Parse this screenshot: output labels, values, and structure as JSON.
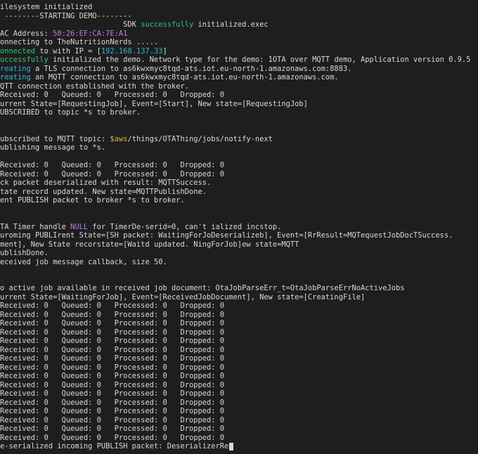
{
  "lines": [
    [
      {
        "t": "ilesystem initialized"
      }
    ],
    [
      {
        "t": " --------STARTING DEMO--------"
      }
    ],
    [
      {
        "t": "                            SDK "
      },
      {
        "t": "successfully",
        "c": "g"
      },
      {
        "t": " initialized.exec"
      }
    ],
    [
      {
        "t": "AC Address: "
      },
      {
        "t": "50:26:EF:CA:7E:A1",
        "c": "m"
      }
    ],
    [
      {
        "t": "onnecting to TheNutritionNerds ....."
      }
    ],
    [
      {
        "t": "onnected ",
        "c": "g"
      },
      {
        "t": "to with IP = ["
      },
      {
        "t": "192.168.137.33",
        "c": "c"
      },
      {
        "t": "]"
      }
    ],
    [
      {
        "t": "uccessfully ",
        "c": "g"
      },
      {
        "t": "initialized the demo. Network type for the demo: 1OTA over MQTT demo, Application version 0.9.5"
      }
    ],
    [
      {
        "t": "reating ",
        "c": "c"
      },
      {
        "t": "a TLS connection to as6kwxmyc8tqd-ats.iot.eu-north-1.amazonaws.com:8883."
      }
    ],
    [
      {
        "t": "reating ",
        "c": "c"
      },
      {
        "t": "an MQTT connection to as6kwxmyc8tqd-ats.iot.eu-north-1.amazonaws.com."
      }
    ],
    [
      {
        "t": "QTT connection established with the broker."
      }
    ],
    [
      {
        "t": "Received: 0   Queued: 0   Processed: 0   Dropped: 0"
      }
    ],
    [
      {
        "t": "urrent State=[RequestingJob], Event=[Start], New state=[RequestingJob]"
      }
    ],
    [
      {
        "t": "UBSCRIBED to topic *s to broker."
      }
    ],
    [
      {
        "t": ""
      }
    ],
    [
      {
        "t": ""
      }
    ],
    [
      {
        "t": "ubscribed to MQTT topic: "
      },
      {
        "t": "$aws",
        "c": "y"
      },
      {
        "t": "/things/OTAThing/jobs/notify-next"
      }
    ],
    [
      {
        "t": "ublishing message to *s."
      }
    ],
    [
      {
        "t": ""
      }
    ],
    [
      {
        "t": "Received: 0   Queued: 0   Processed: 0   Dropped: 0"
      }
    ],
    [
      {
        "t": "Received: 0   Queued: 0   Processed: 0   Dropped: 0"
      }
    ],
    [
      {
        "t": "ck packet deserialized with result: MQTTSuccess."
      }
    ],
    [
      {
        "t": "tate record updated. New state=MQTTPublishDone."
      }
    ],
    [
      {
        "t": "ent PUBLISH packet to broker *s to broker."
      }
    ],
    [
      {
        "t": ""
      }
    ],
    [
      {
        "t": ""
      }
    ],
    [
      {
        "t": "TA Timer handle "
      },
      {
        "t": "NULL",
        "c": "m"
      },
      {
        "t": " for TimerDe-serid=0, can't ialized incstop."
      }
    ],
    [
      {
        "t": "uroming PUBLIrent State=[SH packet: WaitingForJoDeserializeb], Event=[RrResult=MQTequestJobDocTSuccess."
      }
    ],
    [
      {
        "t": "ment], New State recorstate=[Waitd updated. NingForJob]ew state=MQTT"
      }
    ],
    [
      {
        "t": "ublishDone."
      }
    ],
    [
      {
        "t": "eceived job message callback, size 50."
      }
    ],
    [
      {
        "t": ""
      }
    ],
    [
      {
        "t": ""
      }
    ],
    [
      {
        "t": "o active job available in received job document: OtaJobParseErr_t=OtaJobParseErrNoActiveJobs"
      }
    ],
    [
      {
        "t": "urrent State=[WaitingForJob], Event=[ReceivedJobDocument], New state=[CreatingFile]"
      }
    ],
    [
      {
        "t": "Received: 0   Queued: 0   Processed: 0   Dropped: 0"
      }
    ],
    [
      {
        "t": "Received: 0   Queued: 0   Processed: 0   Dropped: 0"
      }
    ],
    [
      {
        "t": "Received: 0   Queued: 0   Processed: 0   Dropped: 0"
      }
    ],
    [
      {
        "t": "Received: 0   Queued: 0   Processed: 0   Dropped: 0"
      }
    ],
    [
      {
        "t": "Received: 0   Queued: 0   Processed: 0   Dropped: 0"
      }
    ],
    [
      {
        "t": "Received: 0   Queued: 0   Processed: 0   Dropped: 0"
      }
    ],
    [
      {
        "t": "Received: 0   Queued: 0   Processed: 0   Dropped: 0"
      }
    ],
    [
      {
        "t": "Received: 0   Queued: 0   Processed: 0   Dropped: 0"
      }
    ],
    [
      {
        "t": "Received: 0   Queued: 0   Processed: 0   Dropped: 0"
      }
    ],
    [
      {
        "t": "Received: 0   Queued: 0   Processed: 0   Dropped: 0"
      }
    ],
    [
      {
        "t": "Received: 0   Queued: 0   Processed: 0   Dropped: 0"
      }
    ],
    [
      {
        "t": "Received: 0   Queued: 0   Processed: 0   Dropped: 0"
      }
    ],
    [
      {
        "t": "Received: 0   Queued: 0   Processed: 0   Dropped: 0"
      }
    ],
    [
      {
        "t": "Received: 0   Queued: 0   Processed: 0   Dropped: 0"
      }
    ],
    [
      {
        "t": "Received: 0   Queued: 0   Processed: 0   Dropped: 0"
      }
    ],
    [
      {
        "t": "Received: 0   Queued: 0   Processed: 0   Dropped: 0"
      }
    ],
    [
      {
        "t": "e-serialized incoming PUBLISH packet: DeserializerRe"
      }
    ]
  ],
  "cursor_line_index": 50
}
